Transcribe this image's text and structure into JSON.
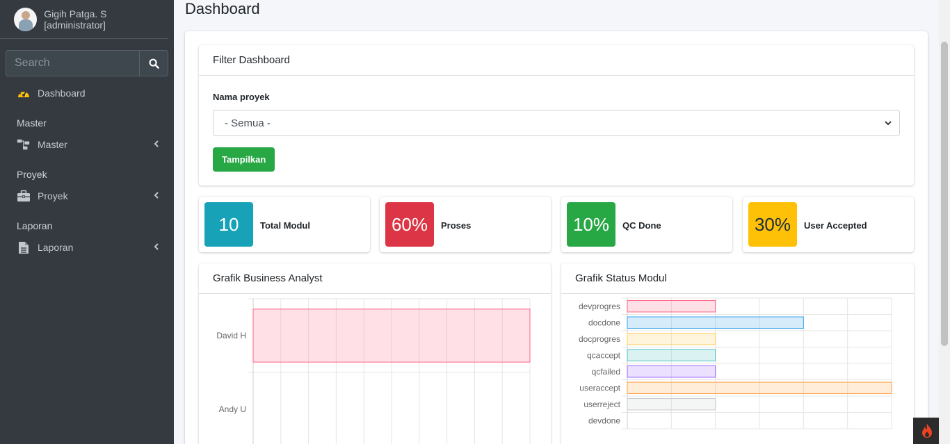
{
  "user": {
    "name": "Gigih Patga. S [administrator]"
  },
  "search": {
    "placeholder": "Search"
  },
  "nav": {
    "dashboard": "Dashboard",
    "master_header": "Master",
    "master": "Master",
    "proyek_header": "Proyek",
    "proyek": "Proyek",
    "laporan_header": "Laporan",
    "laporan": "Laporan"
  },
  "page": {
    "title": "Dashboard"
  },
  "filter": {
    "title": "Filter Dashboard",
    "label": "Nama proyek",
    "selected": "- Semua -",
    "button": "Tampilkan"
  },
  "stats": [
    {
      "value": "10",
      "label": "Total Modul",
      "color": "#17a2b8"
    },
    {
      "value": "60%",
      "label": "Proses",
      "color": "#dc3545"
    },
    {
      "value": "10%",
      "label": "QC Done",
      "color": "#28a745"
    },
    {
      "value": "30%",
      "label": "User Accepted",
      "color": "#ffc107"
    }
  ],
  "charts": {
    "ba_title": "Grafik Business Analyst",
    "status_title": "Grafik Status Modul"
  },
  "chart_data": [
    {
      "type": "bar",
      "orientation": "horizontal",
      "categories": [
        "David H",
        "Andy U"
      ],
      "values": [
        10,
        null
      ],
      "xlim": [
        0,
        10
      ],
      "grid": true,
      "colors": [
        "#ff6384"
      ]
    },
    {
      "type": "bar",
      "orientation": "horizontal",
      "categories": [
        "devprogres",
        "docdone",
        "docprogres",
        "qcaccept",
        "qcfailed",
        "useraccept",
        "userreject",
        "devdone"
      ],
      "values": [
        1,
        2,
        1,
        1,
        1,
        3,
        1,
        null
      ],
      "xlim": [
        0,
        3
      ],
      "grid": true,
      "colors": [
        "#ff6384",
        "#36a2eb",
        "#ffce56",
        "#4bc0c0",
        "#9966ff",
        "#ff9f40",
        "#c9cbcf",
        "#ff6384"
      ]
    }
  ]
}
